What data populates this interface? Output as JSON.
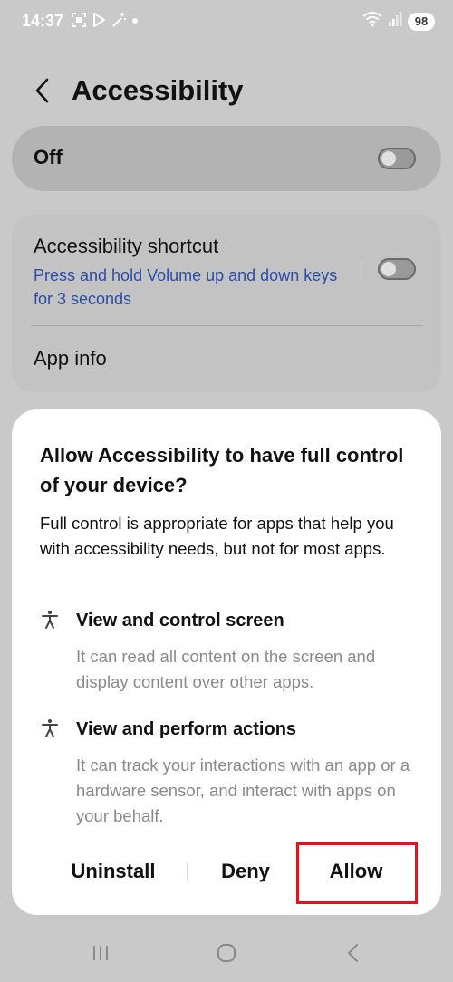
{
  "status_bar": {
    "time": "14:37",
    "battery": "98",
    "left_icons": [
      "screenshot-icon",
      "play-icon",
      "magic-wand-icon",
      "dot-icon"
    ],
    "right_icons": [
      "wifi-icon",
      "signal-icon"
    ]
  },
  "header": {
    "title": "Accessibility"
  },
  "main_toggle": {
    "label": "Off",
    "state": "off"
  },
  "settings": {
    "shortcut_title": "Accessibility shortcut",
    "shortcut_subtitle": "Press and hold Volume up and down keys for 3 seconds",
    "shortcut_toggle_state": "off",
    "app_info_label": "App info",
    "subtitle_color": "#2a4da8"
  },
  "dialog": {
    "title": "Allow Accessibility to have full control of your device?",
    "description": "Full control is appropriate for apps that help you with accessibility needs, but not for most apps.",
    "permissions": [
      {
        "icon": "accessibility-person-icon",
        "title": "View and control screen",
        "description": "It can read all content on the screen and display content over other apps."
      },
      {
        "icon": "accessibility-person-icon",
        "title": "View and perform actions",
        "description": "It can track your interactions with an app or a hardware sensor, and interact with apps on your behalf."
      }
    ],
    "buttons": {
      "uninstall": "Uninstall",
      "deny": "Deny",
      "allow": "Allow"
    },
    "highlight_color": "#e0141c"
  },
  "nav_bar": {
    "icons": [
      "recents-icon",
      "home-icon",
      "back-icon"
    ]
  }
}
